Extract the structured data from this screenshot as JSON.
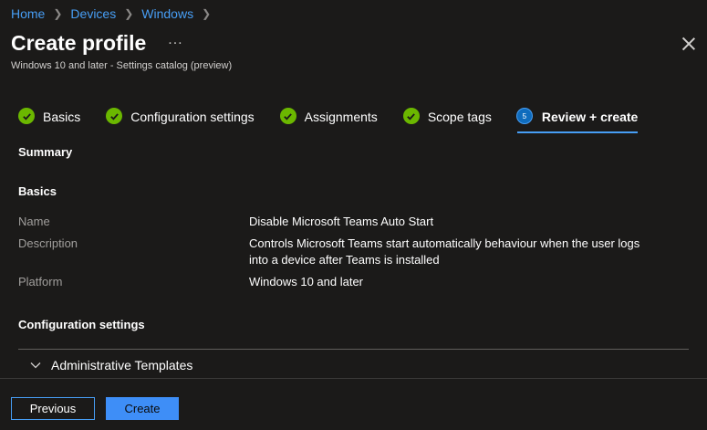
{
  "breadcrumb": [
    "Home",
    "Devices",
    "Windows"
  ],
  "header": {
    "title": "Create profile",
    "more": "...",
    "subtitle": "Windows 10 and later - Settings catalog (preview)"
  },
  "tabs": [
    {
      "label": "Basics",
      "state": "complete"
    },
    {
      "label": "Configuration settings",
      "state": "complete"
    },
    {
      "label": "Assignments",
      "state": "complete"
    },
    {
      "label": "Scope tags",
      "state": "complete"
    },
    {
      "label": "Review + create",
      "state": "active",
      "number": "5"
    }
  ],
  "summary": {
    "heading": "Summary",
    "basics_heading": "Basics",
    "rows": [
      {
        "label": "Name",
        "value": "Disable Microsoft Teams Auto Start"
      },
      {
        "label": "Description",
        "value": "Controls Microsoft Teams start automatically behaviour when the user logs into a device after Teams is installed"
      },
      {
        "label": "Platform",
        "value": "Windows 10 and later"
      }
    ],
    "config_heading": "Configuration settings",
    "expander_label": "Administrative Templates"
  },
  "footer": {
    "previous_label": "Previous",
    "create_label": "Create"
  },
  "colors": {
    "link": "#479ef5",
    "check": "#6bb700",
    "accent": "#3e8ef7",
    "background": "#1b1a19"
  }
}
